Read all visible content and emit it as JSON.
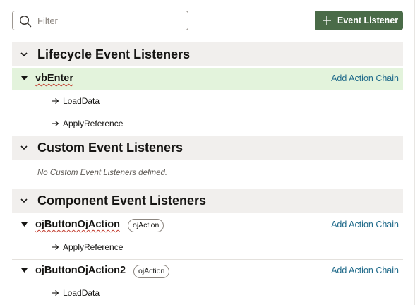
{
  "toolbar": {
    "filter_placeholder": "Filter",
    "add_button_label": "Event Listener"
  },
  "sections": {
    "lifecycle": {
      "title": "Lifecycle Event Listeners",
      "events": [
        {
          "name": "vbEnter",
          "action_label": "Add Action Chain",
          "chains": [
            "LoadData",
            "ApplyReference"
          ]
        }
      ]
    },
    "custom": {
      "title": "Custom Event Listeners",
      "empty_text": "No Custom Event Listeners defined."
    },
    "component": {
      "title": "Component Event Listeners",
      "events": [
        {
          "name": "ojButtonOjAction",
          "badge": "ojAction",
          "action_label": "Add Action Chain",
          "chains": [
            "ApplyReference"
          ]
        },
        {
          "name": "ojButtonOjAction2",
          "badge": "ojAction",
          "action_label": "Add Action Chain",
          "chains": [
            "LoadData"
          ]
        }
      ]
    }
  },
  "colors": {
    "primary_button": "#4a6b48",
    "selected_row": "#e3f3dc",
    "section_header": "#f1efed",
    "link": "#1f6a8a"
  },
  "icons": [
    "search-icon",
    "plus-icon",
    "chevron-down-icon",
    "caret-down-icon",
    "arrow-right-icon"
  ]
}
